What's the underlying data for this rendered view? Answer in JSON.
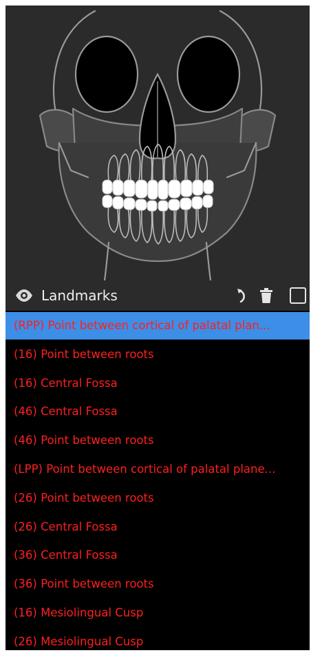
{
  "header": {
    "title": "Landmarks",
    "eye_icon": "eye-icon",
    "reset_icon": "undo-arrow-icon",
    "delete_icon": "trash-icon",
    "checkbox_icon": "checkbox-icon"
  },
  "colors": {
    "panel_bg": "#2b2b2b",
    "list_bg": "#000000",
    "selected_bg": "#3d8ee6",
    "item_text": "#ff1f1f",
    "header_text": "#f0f0f0"
  },
  "landmarks": [
    {
      "label": "(RPP) Point between cortical of palatal plan...",
      "selected": true
    },
    {
      "label": "(16) Point between roots",
      "selected": false
    },
    {
      "label": "(16) Central Fossa",
      "selected": false
    },
    {
      "label": "(46) Central Fossa",
      "selected": false
    },
    {
      "label": "(46) Point between roots",
      "selected": false
    },
    {
      "label": "(LPP) Point between cortical of palatal plane...",
      "selected": false
    },
    {
      "label": "(26) Point between roots",
      "selected": false
    },
    {
      "label": "(26) Central Fossa",
      "selected": false
    },
    {
      "label": "(36) Central Fossa",
      "selected": false
    },
    {
      "label": "(36) Point between roots",
      "selected": false
    },
    {
      "label": "(16) Mesiolingual Cusp",
      "selected": false
    },
    {
      "label": "(26) Mesiolingual Cusp",
      "selected": false
    }
  ]
}
